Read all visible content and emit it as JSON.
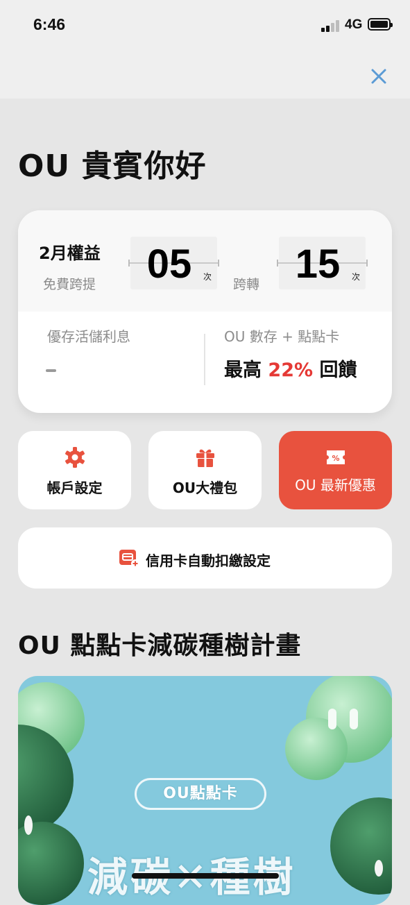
{
  "status": {
    "time": "6:46",
    "network": "4G"
  },
  "greeting": "OU 貴賓你好",
  "benefits": {
    "month_title": "2月權益",
    "free_withdraw_label": "免費跨提",
    "free_withdraw_count": "05",
    "transfer_label": "跨轉",
    "transfer_count": "15",
    "unit": "次",
    "savings_interest_label": "優存活儲利息",
    "savings_interest_value": "-",
    "card_promo_label": "OU 數存 + 點點卡",
    "reward_prefix": "最高 ",
    "reward_pct": "22%",
    "reward_suffix": " 回饋"
  },
  "tiles": [
    {
      "label": "帳戶設定",
      "icon": "gear-icon"
    },
    {
      "label": "OU大禮包",
      "icon": "gift-icon"
    },
    {
      "label": "OU 最新優惠",
      "icon": "coupon-icon"
    }
  ],
  "autopay": {
    "label": "信用卡自動扣繳設定",
    "icon": "credit-card-add-icon"
  },
  "section_title": "OU 點點卡減碳種樹計畫",
  "banner": {
    "pill": "OU點點卡",
    "headline": "減碳✕種樹"
  },
  "colors": {
    "accent_red": "#e8523e",
    "highlight_red": "#e53935",
    "banner_blue": "#84c9dd",
    "close_blue": "#5b9bd5"
  }
}
